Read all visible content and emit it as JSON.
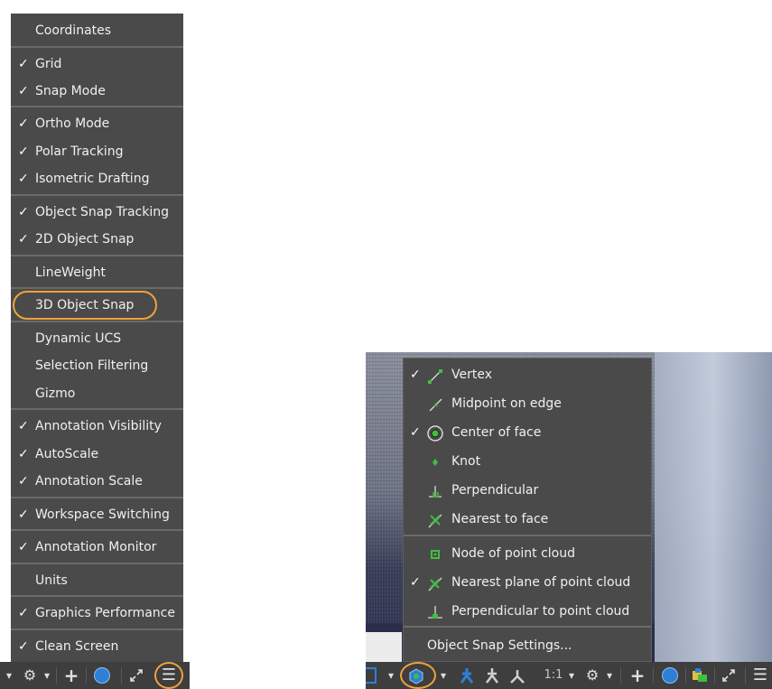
{
  "left_menu": {
    "items": [
      {
        "label": "Coordinates",
        "checked": false
      },
      {
        "label": "Grid",
        "checked": true
      },
      {
        "label": "Snap Mode",
        "checked": true
      },
      {
        "label": "Ortho Mode",
        "checked": true
      },
      {
        "label": "Polar Tracking",
        "checked": true
      },
      {
        "label": "Isometric Drafting",
        "checked": true
      },
      {
        "label": "Object Snap Tracking",
        "checked": true
      },
      {
        "label": "2D Object Snap",
        "checked": true
      },
      {
        "label": "LineWeight",
        "checked": false
      },
      {
        "label": "3D Object Snap",
        "checked": false,
        "highlighted": true
      },
      {
        "label": "Dynamic UCS",
        "checked": false
      },
      {
        "label": "Selection Filtering",
        "checked": false
      },
      {
        "label": "Gizmo",
        "checked": false
      },
      {
        "label": "Annotation Visibility",
        "checked": true
      },
      {
        "label": "AutoScale",
        "checked": true
      },
      {
        "label": "Annotation Scale",
        "checked": true
      },
      {
        "label": "Workspace Switching",
        "checked": true
      },
      {
        "label": "Annotation Monitor",
        "checked": true
      },
      {
        "label": "Units",
        "checked": false
      },
      {
        "label": "Graphics Performance",
        "checked": true
      },
      {
        "label": "Clean Screen",
        "checked": true
      }
    ],
    "check_glyph": "✓"
  },
  "snap_menu": {
    "items": [
      {
        "label": "Vertex",
        "checked": true,
        "icon": "vertex-snap-icon"
      },
      {
        "label": "Midpoint on edge",
        "checked": false,
        "icon": "midpoint-edge-snap-icon"
      },
      {
        "label": "Center of face",
        "checked": true,
        "icon": "center-face-snap-icon"
      },
      {
        "label": "Knot",
        "checked": false,
        "icon": "knot-snap-icon"
      },
      {
        "label": "Perpendicular",
        "checked": false,
        "icon": "perpendicular-snap-icon"
      },
      {
        "label": "Nearest to face",
        "checked": false,
        "icon": "nearest-face-snap-icon"
      },
      {
        "label": "Node of point cloud",
        "checked": false,
        "icon": "node-cloud-snap-icon"
      },
      {
        "label": "Nearest plane of point cloud",
        "checked": true,
        "icon": "nearest-plane-snap-icon"
      },
      {
        "label": "Perpendicular to point cloud",
        "checked": false,
        "icon": "perpendicular-cloud-snap-icon"
      }
    ],
    "settings_label": "Object Snap Settings..."
  },
  "status_bar": {
    "scale_label": "1:1",
    "dropdown_glyph": "▾",
    "plus_glyph": "+",
    "menu_glyph": "☰",
    "gear_glyph": "⚙"
  },
  "colors": {
    "menu_bg": "#4a4a4a",
    "status_bg": "#3e3e3e",
    "highlight": "#f0a23a",
    "snap_green": "#3fbf3f",
    "accent_blue": "#2f7ed8"
  }
}
